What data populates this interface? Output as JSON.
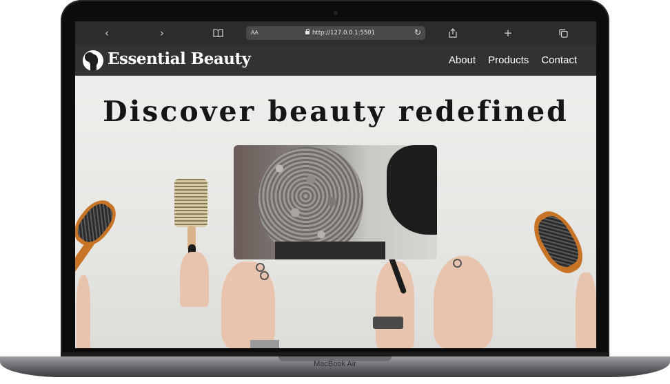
{
  "device": {
    "model_label": "MacBook Air"
  },
  "browser": {
    "text_size_label": "AA",
    "url": "http://127.0.0.1:5501",
    "icons": {
      "back": "chevron-left-icon",
      "forward": "chevron-right-icon",
      "bookmarks": "book-icon",
      "reload": "reload-icon",
      "share": "share-icon",
      "new_tab": "plus-icon",
      "tabs": "tabs-icon"
    }
  },
  "site": {
    "brand": "Essential Beauty",
    "nav": [
      {
        "label": "About"
      },
      {
        "label": "Products"
      },
      {
        "label": "Contact"
      }
    ],
    "hero_title": "Discover beauty redefined"
  },
  "colors": {
    "nav_background": "#323232",
    "toolbar_background": "#2c2c2e",
    "hero_background": "#e9e9e8",
    "brand_text": "#ffffff"
  }
}
